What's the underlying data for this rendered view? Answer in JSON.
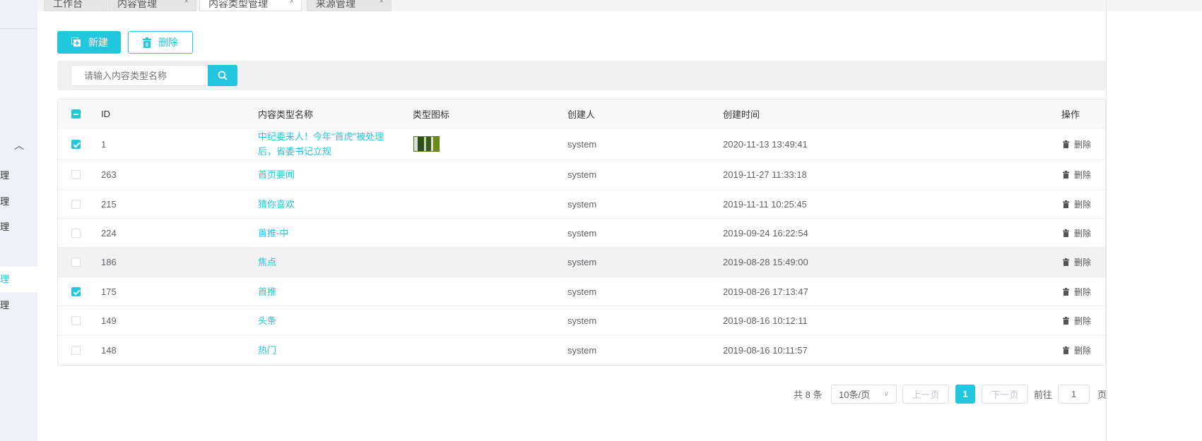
{
  "sidebar": {
    "items": [
      {
        "label": "管理"
      },
      {
        "label": "管理"
      },
      {
        "label": "管理"
      },
      {
        "label": "管理",
        "active": true
      },
      {
        "label": "管理"
      }
    ]
  },
  "tabs": [
    {
      "label": "工作台"
    },
    {
      "label": "内容管理",
      "close": "×"
    },
    {
      "label": "内容类型管理",
      "close": "×",
      "active": true
    },
    {
      "label": "来源管理",
      "close": "×"
    }
  ],
  "toolbar": {
    "new_label": "新建",
    "delete_label": "删除"
  },
  "search": {
    "placeholder": "请输入内容类型名称",
    "value": ""
  },
  "table": {
    "headers": {
      "id": "ID",
      "name": "内容类型名称",
      "icon": "类型图标",
      "creator": "创建人",
      "time": "创建时间",
      "op": "操作"
    },
    "rows": [
      {
        "checked": true,
        "id": "1",
        "name": "中纪委来人！今年\"首虎\"被处理后，省委书记立规",
        "name_line1": "中纪委来人！今年\"首虎\"被处理",
        "name_line2": "后，省委书记立规",
        "has_icon": true,
        "creator": "system",
        "time": "2020-11-13 13:49:41",
        "op": "删除"
      },
      {
        "checked": false,
        "id": "263",
        "name": "首页要闻",
        "creator": "system",
        "time": "2019-11-27 11:33:18",
        "op": "删除"
      },
      {
        "checked": false,
        "id": "215",
        "name": "猜你喜欢",
        "creator": "system",
        "time": "2019-11-11 10:25:45",
        "op": "删除"
      },
      {
        "checked": false,
        "id": "224",
        "name": "首推-中",
        "creator": "system",
        "time": "2019-09-24 16:22:54",
        "op": "删除"
      },
      {
        "checked": false,
        "id": "186",
        "name": "焦点",
        "creator": "system",
        "time": "2019-08-28 15:49:00",
        "op": "删除"
      },
      {
        "checked": true,
        "id": "175",
        "name": "首推",
        "creator": "system",
        "time": "2019-08-26 17:13:47",
        "op": "删除"
      },
      {
        "checked": false,
        "id": "149",
        "name": "头条",
        "creator": "system",
        "time": "2019-08-16 10:12:11",
        "op": "删除"
      },
      {
        "checked": false,
        "id": "148",
        "name": "热门",
        "creator": "system",
        "time": "2019-08-16 10:11:57",
        "op": "删除"
      }
    ]
  },
  "pagination": {
    "total": "共 8 条",
    "page_size": "10条/页",
    "prev": "上一页",
    "current": "1",
    "next": "下一页",
    "goto_label": "前往",
    "goto_value": "1",
    "page_suffix": "页"
  },
  "colors": {
    "accent": "#23c6df"
  }
}
